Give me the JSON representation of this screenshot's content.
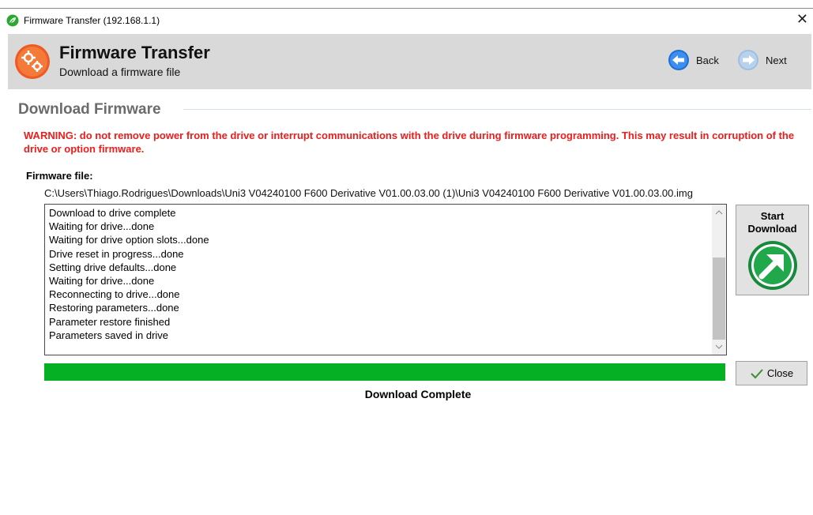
{
  "window": {
    "title": "Firmware Transfer (192.168.1.1)",
    "close_glyph": "✕"
  },
  "header": {
    "title": "Firmware Transfer",
    "subtitle": "Download a firmware file",
    "back_label": "Back",
    "next_label": "Next"
  },
  "section": {
    "title": "Download Firmware"
  },
  "warning": "WARNING: do not remove power from the drive or interrupt communications with the drive during firmware programming. This may result in corruption of the drive or option firmware.",
  "firmware": {
    "label": "Firmware file:",
    "path": "C:\\Users\\Thiago.Rodrigues\\Downloads\\Uni3 V04240100 F600 Derivative V01.00.03.00 (1)\\Uni3 V04240100 F600 Derivative V01.00.03.00.img"
  },
  "log": [
    "Download to drive complete",
    "Waiting for drive...done",
    "Waiting for drive option slots...done",
    "Drive reset in progress...done",
    "Setting drive defaults...done",
    "Waiting for drive...done",
    "Reconnecting to drive...done",
    "Restoring parameters...done",
    "Parameter restore finished",
    "Parameters saved in drive"
  ],
  "start_button": {
    "line1": "Start",
    "line2": "Download"
  },
  "progress": {
    "value_percent": 100,
    "status": "Download Complete"
  },
  "close_button": {
    "label": "Close"
  },
  "colors": {
    "warning": "#ee1c1c",
    "progress": "#06b025",
    "header_bg": "#d9d9d9",
    "nav_blue": "#1f6fd1"
  },
  "icons": {
    "app": "leaf-icon",
    "logo": "gears-icon",
    "back": "back-arrow-icon",
    "next": "next-arrow-icon",
    "start": "download-arrow-icon",
    "close": "checkmark-icon"
  }
}
